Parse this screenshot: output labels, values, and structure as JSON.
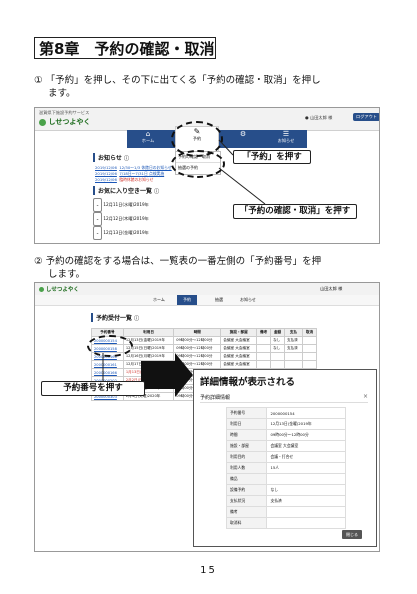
{
  "chapter_title": "第8章　予約の確認・取消",
  "steps": [
    {
      "num": "①",
      "text_line1": "「予約」を押し、その下に出てくる「予約の確認・取消」を押し",
      "text_line2": "ます。"
    },
    {
      "num": "②",
      "text_line1": "予約の確認をする場合は、一覧表の一番左側の「予約番号」を押",
      "text_line2": "します。"
    }
  ],
  "screen1": {
    "service_label": "滋賀県下施設予約サービス",
    "logo": "しせつよやく",
    "user_label": "山田太郎 様",
    "logout": "ログアウト",
    "nav": [
      {
        "label": "ホーム",
        "icon": "home-icon"
      },
      {
        "label": "予約",
        "icon": "edit-icon"
      },
      {
        "label": "",
        "icon": "gear-icon"
      },
      {
        "label": "お知らせ",
        "icon": "list-icon"
      }
    ],
    "dropdown": [
      "予約の確認・取消",
      "抽選の予約"
    ],
    "notice_title": "お知らせ",
    "notices": [
      {
        "date": "2019/12/06",
        "text": "12/30～1/3 休館日のお知らせ"
      },
      {
        "date": "2019/12/06",
        "text": "7/18日～7/31日 点検実施"
      },
      {
        "date": "2019/12/06",
        "text": "臨時休館のお知らせ"
      }
    ],
    "fav_title": "お気に入り空き一覧",
    "favorites": [
      "12月11日(水曜)2019年",
      "12月12日(木曜)2019年",
      "12月13日(金曜)2019年"
    ],
    "callout_reserve": "「予約」を押す",
    "callout_confirm": "「予約の確認・取消」を押す"
  },
  "screen2": {
    "logo": "しせつよやく",
    "user_label": "山田太郎 様",
    "nav": [
      "ホーム",
      "予約",
      "抽選",
      "お知らせ"
    ],
    "list_title": "予約受付一覧",
    "headers": [
      "予約番号",
      "利用日",
      "時間",
      "施設・部屋",
      "備考",
      "金額",
      "支払",
      "取消"
    ],
    "rows": [
      {
        "id": "2000000154",
        "date": "12月13日(金曜)2019年",
        "time": "09時00分～12時00分",
        "place": "会議室 大会議室"
      },
      {
        "id": "2000000158",
        "date": "12月15日(日曜)2019年",
        "time": "09時00分～12時00分",
        "place": "会議室 大会議室"
      },
      {
        "id": "2000000160",
        "date": "12月16日(月曜)2019年",
        "time": "09時00分～12時00分",
        "place": "会議室 大会議室"
      },
      {
        "id": "2000000161",
        "date": "12月17日(火曜)2019年",
        "time": "09時00分～12時00分",
        "place": "会議室 大会議室"
      },
      {
        "id": "2000000166",
        "date": "1月13日(月曜)2020年",
        "time": "09時00分～12時00分",
        "place": "会議室 大会議室"
      },
      {
        "id": "2000000202",
        "date": "2月2日(日曜)2020年",
        "time": "09時00分～12時00分",
        "place": "会議室 大会議室"
      },
      {
        "id": "2000000203",
        "date": "2月4日(火曜)2020年",
        "time": "09時00分～12時00分",
        "place": "会議室 大会議室"
      },
      {
        "id": "2000000303",
        "date": "2月4日(火曜)2020年",
        "time": "09時00分～12時00分",
        "place": "会議室 大会議室"
      }
    ],
    "row_extra": [
      "なし",
      "支払済"
    ],
    "back_button": "戻る",
    "callout_id": "予約番号を押す",
    "modal_header": "詳細情報が表示される",
    "modal_title": "予約詳細情報",
    "modal_rows": [
      {
        "k": "予約番号",
        "v": "2000000154"
      },
      {
        "k": "利用日",
        "v": "12月13日(金曜)2019年"
      },
      {
        "k": "時間",
        "v": "09時00分～12時00分"
      },
      {
        "k": "施設・部屋",
        "v": "会議室 大会議室"
      },
      {
        "k": "利用目的",
        "v": "会議・打合せ"
      },
      {
        "k": "利用人数",
        "v": "15人"
      },
      {
        "k": "備品",
        "v": ""
      },
      {
        "k": "設備予約",
        "v": "なし"
      },
      {
        "k": "支払状況",
        "v": "支払済"
      },
      {
        "k": "備考",
        "v": ""
      },
      {
        "k": "取消料",
        "v": ""
      }
    ],
    "modal_close": "閉じる"
  },
  "page_number": "15",
  "colors": {
    "nav": "#274e8a",
    "brand": "#1a6a1a",
    "link": "#1a56b7",
    "red": "#d0332b"
  }
}
